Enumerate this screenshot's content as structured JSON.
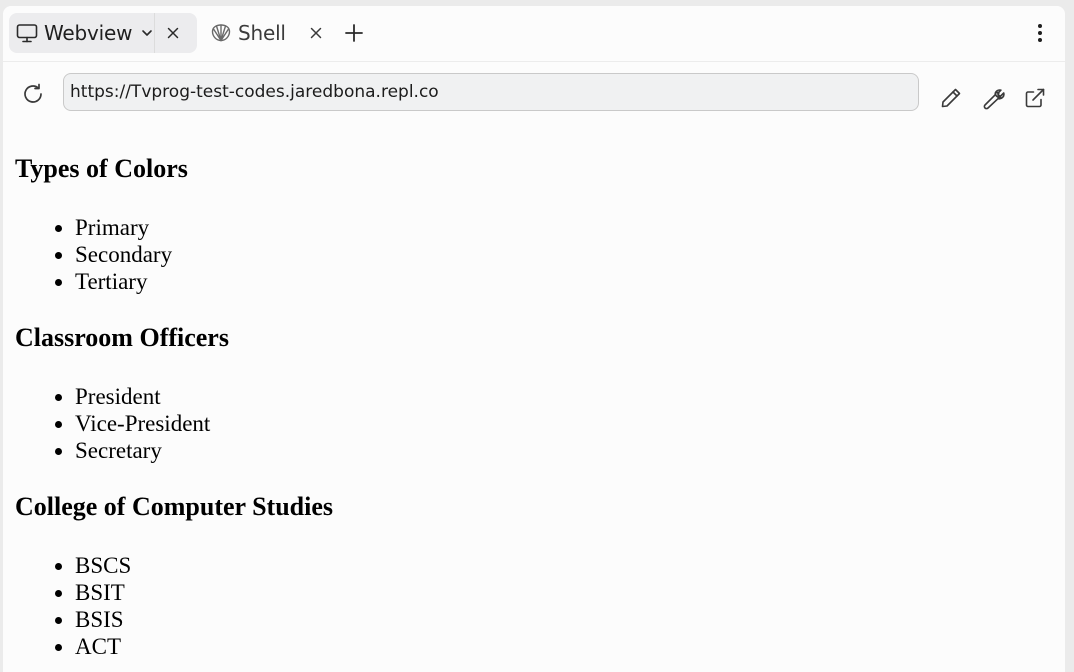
{
  "tabs": [
    {
      "label": "Webview",
      "icon": "monitor-icon",
      "active": true
    },
    {
      "label": "Shell",
      "icon": "shell-icon",
      "active": false
    }
  ],
  "address_bar": {
    "url": "https://Tvprog-test-codes.jaredbona.repl.co"
  },
  "page": {
    "sections": [
      {
        "title": "Types of Colors",
        "items": [
          "Primary",
          "Secondary",
          "Tertiary"
        ]
      },
      {
        "title": "Classroom Officers",
        "items": [
          "President",
          "Vice-President",
          "Secretary"
        ]
      },
      {
        "title": "College of Computer Studies",
        "items": [
          "BSCS",
          "BSIT",
          "BSIS",
          "ACT"
        ]
      }
    ]
  },
  "colors": {
    "window_bg": "#fcfcfc",
    "active_tab_bg": "#ececee",
    "url_field_bg": "#f0f1f2",
    "icon_color": "#3a3a3a"
  }
}
